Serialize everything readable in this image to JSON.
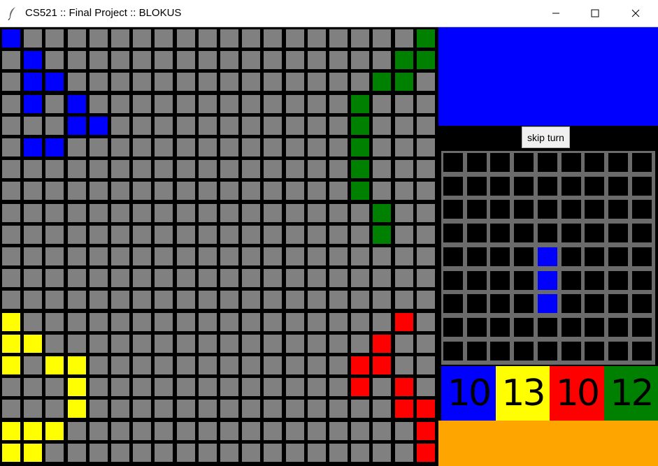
{
  "window": {
    "title": "CS521 :: Final Project :: BLOKUS",
    "app_icon": "feather-icon",
    "controls": [
      "minimize-icon",
      "maximize-icon",
      "close-icon"
    ]
  },
  "colors": {
    "empty": "#808080",
    "blue": "#0000ff",
    "green": "#008000",
    "yellow": "#ffff00",
    "red": "#ff0000",
    "black": "#000000",
    "orange": "#ffa500"
  },
  "board": {
    "rows": 20,
    "cols": 20,
    "blue": [
      [
        0,
        0
      ],
      [
        1,
        1
      ],
      [
        2,
        1
      ],
      [
        2,
        2
      ],
      [
        3,
        1
      ],
      [
        3,
        3
      ],
      [
        4,
        3
      ],
      [
        4,
        4
      ],
      [
        5,
        1
      ],
      [
        5,
        2
      ]
    ],
    "green": [
      [
        0,
        19
      ],
      [
        1,
        18
      ],
      [
        1,
        19
      ],
      [
        2,
        17
      ],
      [
        2,
        18
      ],
      [
        3,
        16
      ],
      [
        4,
        16
      ],
      [
        5,
        16
      ],
      [
        6,
        16
      ],
      [
        7,
        16
      ],
      [
        8,
        17
      ],
      [
        9,
        17
      ]
    ],
    "yellow": [
      [
        13,
        0
      ],
      [
        14,
        0
      ],
      [
        14,
        1
      ],
      [
        15,
        0
      ],
      [
        15,
        2
      ],
      [
        15,
        3
      ],
      [
        16,
        3
      ],
      [
        17,
        3
      ],
      [
        18,
        0
      ],
      [
        18,
        1
      ],
      [
        18,
        2
      ],
      [
        19,
        0
      ],
      [
        19,
        1
      ]
    ],
    "red": [
      [
        13,
        18
      ],
      [
        14,
        17
      ],
      [
        15,
        16
      ],
      [
        15,
        17
      ],
      [
        16,
        16
      ],
      [
        16,
        18
      ],
      [
        17,
        18
      ],
      [
        17,
        19
      ],
      [
        18,
        19
      ],
      [
        19,
        19
      ]
    ]
  },
  "current_player_color": "#0000ff",
  "skip_button": {
    "label": "skip turn"
  },
  "selected_piece": {
    "rows": 9,
    "cols": 9,
    "cells": [
      [
        4,
        4
      ],
      [
        5,
        4
      ],
      [
        6,
        4
      ]
    ]
  },
  "scores": [
    {
      "player": "blue",
      "value": "10",
      "color": "#0000ff"
    },
    {
      "player": "yellow",
      "value": "13",
      "color": "#ffff00"
    },
    {
      "player": "red",
      "value": "10",
      "color": "#ff0000"
    },
    {
      "player": "green",
      "value": "12",
      "color": "#008000"
    }
  ]
}
